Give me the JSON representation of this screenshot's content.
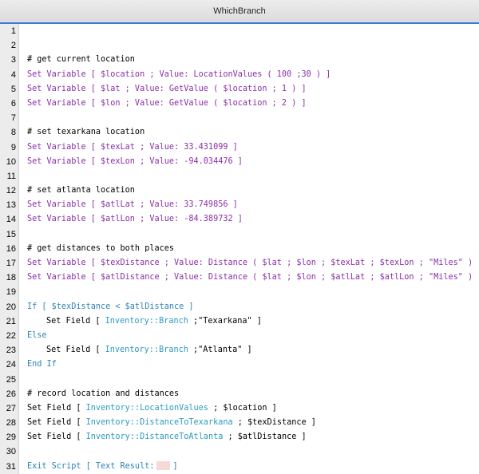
{
  "window": {
    "title": "WhichBranch"
  },
  "lines": [
    {
      "n": "1"
    },
    {
      "n": "2"
    },
    {
      "n": "3",
      "text": "# get current location"
    },
    {
      "n": "4",
      "text": "Set Variable [ $location ; Value: LocationValues ( 100 ;30 ) ]"
    },
    {
      "n": "5",
      "text": "Set Variable [ $lat ; Value: GetValue ( $location ; 1 ) ]"
    },
    {
      "n": "6",
      "text": "Set Variable [ $lon ; Value: GetValue ( $location ; 2 ) ]"
    },
    {
      "n": "7"
    },
    {
      "n": "8",
      "text": "# set texarkana location"
    },
    {
      "n": "9",
      "text": "Set Variable [ $texLat ; Value: 33.431099 ]"
    },
    {
      "n": "10",
      "text": "Set Variable [ $texLon ; Value: -94.034476 ]"
    },
    {
      "n": "11"
    },
    {
      "n": "12",
      "text": "# set atlanta location"
    },
    {
      "n": "13",
      "text": "Set Variable [ $atlLat ; Value: 33.749856 ]"
    },
    {
      "n": "14",
      "text": "Set Variable [ $atlLon ; Value: -84.389732 ]"
    },
    {
      "n": "15"
    },
    {
      "n": "16",
      "text": "# get distances to both places"
    },
    {
      "n": "17",
      "text": "Set Variable [ $texDistance ; Value: Distance ( $lat ; $lon ; $texLat ; $texLon ; \"Miles\" ) ]"
    },
    {
      "n": "18",
      "text": "Set Variable [ $atlDistance ; Value: Distance ( $lat ; $lon ; $atlLat ; $atlLon ; \"Miles\" ) ]"
    },
    {
      "n": "19"
    },
    {
      "n": "20",
      "text": "If [ $texDistance < $atlDistance ]"
    },
    {
      "n": "21",
      "pre": "Set Field [ ",
      "field": "Inventory::Branch",
      "post": " ;\"Texarkana\" ]"
    },
    {
      "n": "22",
      "text": "Else"
    },
    {
      "n": "23",
      "pre": "Set Field [ ",
      "field": "Inventory::Branch",
      "post": " ;\"Atlanta\" ]"
    },
    {
      "n": "24",
      "text": "End If"
    },
    {
      "n": "25"
    },
    {
      "n": "26",
      "text": "# record location and distances"
    },
    {
      "n": "27",
      "pre": "Set Field [ ",
      "field": "Inventory::LocationValues",
      "post": " ; $location ]"
    },
    {
      "n": "28",
      "pre": "Set Field [ ",
      "field": "Inventory::DistanceToTexarkana",
      "post": " ; $texDistance ]"
    },
    {
      "n": "29",
      "pre": "Set Field [ ",
      "field": "Inventory::DistanceToAtlanta",
      "post": " ; $atlDistance ]"
    },
    {
      "n": "30"
    },
    {
      "n": "31",
      "text": "Exit Script [ Text Result:",
      "end": "]"
    }
  ],
  "colors": {
    "script_step": "#8a2fa8",
    "control_step": "#2e83b3",
    "field_ref": "#2e9ac0",
    "selection_bar": "#3a7bd5"
  }
}
